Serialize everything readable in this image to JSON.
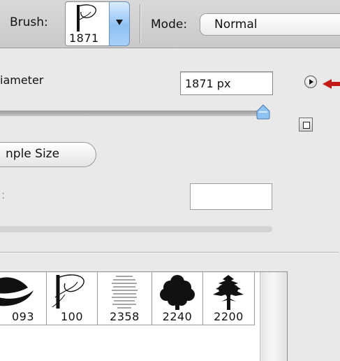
{
  "options_bar": {
    "brush_label": "Brush:",
    "brush_preview_size": "1871",
    "mode_label": "Mode:",
    "mode_value": "Normal"
  },
  "brush_panel": {
    "diameter_label": "iameter",
    "diameter_value": "1871 px",
    "sample_size_label": "nple Size",
    "faded_label": ":",
    "faded_value": ""
  },
  "presets": [
    {
      "size": "093",
      "icon": "leaf-brush-icon"
    },
    {
      "size": "100",
      "icon": "script-p-brush-icon"
    },
    {
      "size": "2358",
      "icon": "text-page-brush-icon"
    },
    {
      "size": "2240",
      "icon": "tree-brush-icon"
    },
    {
      "size": "2200",
      "icon": "tree-brush-icon"
    }
  ],
  "colors": {
    "pointer_arrow": "#c41a16",
    "dropdown_accent": "#8fc1f3",
    "slider_thumb": "#8fc3f4"
  },
  "sliders": {
    "diameter_level": 0.96
  }
}
